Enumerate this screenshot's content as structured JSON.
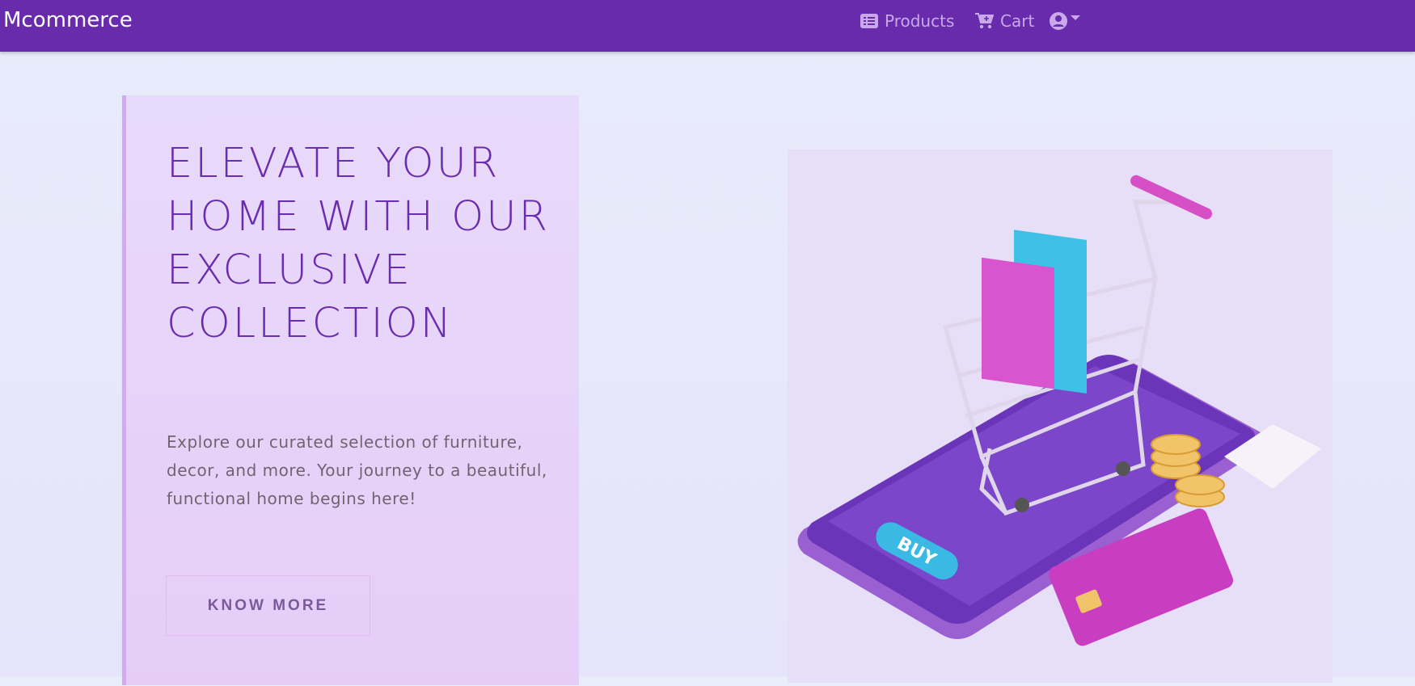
{
  "navbar": {
    "brand": "Mcommerce",
    "products_label": "Products",
    "cart_label": "Cart"
  },
  "hero": {
    "title": "ELEVATE YOUR HOME WITH OUR EXCLUSIVE COLLECTION",
    "description": "Explore our curated selection of furniture, decor, and more. Your journey to a beautiful, functional home begins here!",
    "button_label": "KNOW MORE"
  },
  "illustration": {
    "buy_label": "BUY"
  },
  "colors": {
    "navbar": "#672bab",
    "accent": "#6a2dad"
  }
}
